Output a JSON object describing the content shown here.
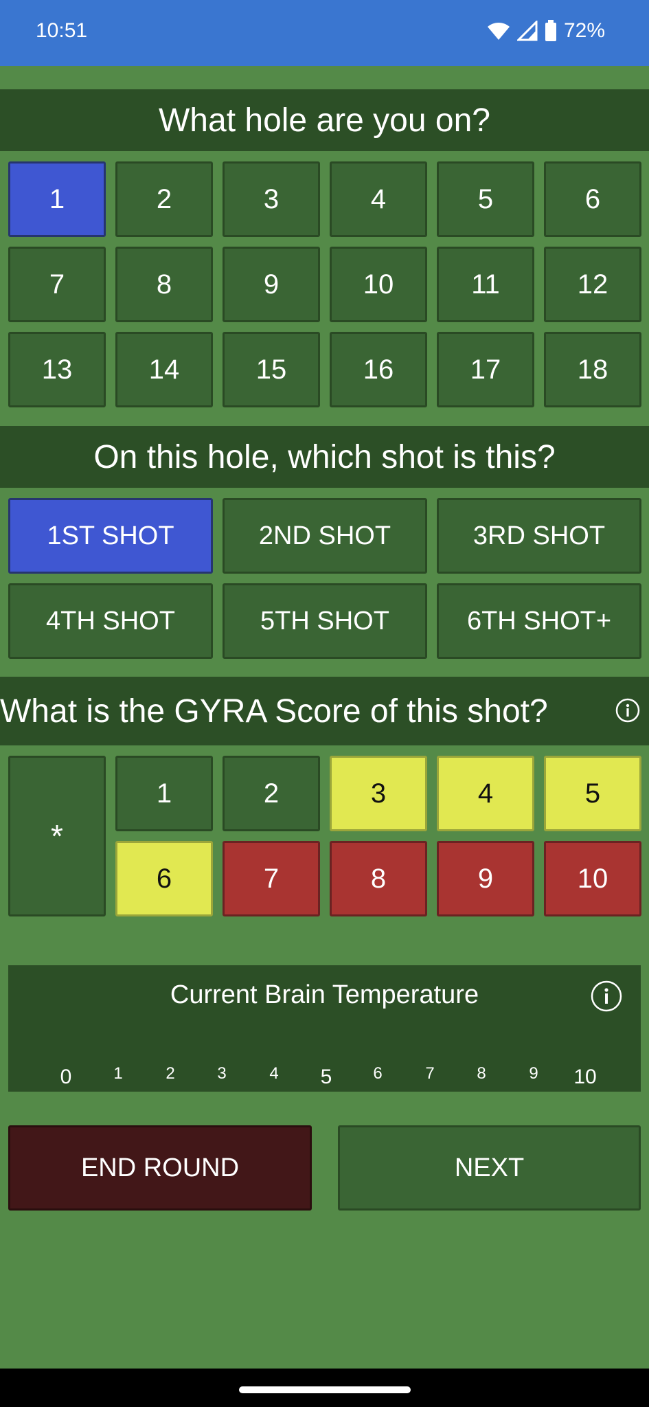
{
  "status": {
    "time": "10:51",
    "battery": "72%"
  },
  "hole_section": {
    "title": "What hole are you on?",
    "holes": [
      "1",
      "2",
      "3",
      "4",
      "5",
      "6",
      "7",
      "8",
      "9",
      "10",
      "11",
      "12",
      "13",
      "14",
      "15",
      "16",
      "17",
      "18"
    ],
    "selected": "1"
  },
  "shot_section": {
    "title": "On this hole, which shot is this?",
    "shots": [
      "1ST SHOT",
      "2ND SHOT",
      "3RD SHOT",
      "4TH SHOT",
      "5TH SHOT",
      "6TH SHOT+"
    ],
    "selected": "1ST SHOT"
  },
  "score_section": {
    "title": "What is the GYRA Score of this shot?",
    "star": "*",
    "scores": [
      "1",
      "2",
      "3",
      "4",
      "5",
      "6",
      "7",
      "8",
      "9",
      "10"
    ]
  },
  "temperature": {
    "title": "Current Brain Temperature",
    "ticks": [
      "0",
      "1",
      "2",
      "3",
      "4",
      "5",
      "6",
      "7",
      "8",
      "9",
      "10"
    ]
  },
  "actions": {
    "end_round": "END ROUND",
    "next": "NEXT"
  },
  "colors": {
    "selected": "#3f57d2",
    "yellow": "#e1e851",
    "red": "#a93431",
    "accent": "#3a76d0"
  }
}
